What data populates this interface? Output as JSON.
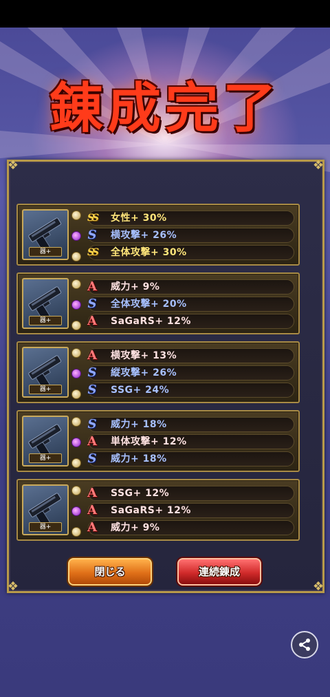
{
  "title": "錬成完了",
  "weapon_label": "器+",
  "colors": {
    "rank_S": "#8fa8ff",
    "rank_SS": "#ffd54a",
    "rank_A": "#ff7a7a",
    "frame_gold": "#b89a4a"
  },
  "cards": [
    {
      "sockets": [
        "white",
        "purple"
      ],
      "stats": [
        {
          "rank": "SS",
          "text": "女性+ 30%"
        },
        {
          "rank": "S",
          "text": "横攻撃+ 26%"
        },
        {
          "rank": "SS",
          "text": "全体攻撃+ 30%"
        }
      ]
    },
    {
      "sockets": [
        "white",
        "purple"
      ],
      "stats": [
        {
          "rank": "A",
          "text": "威力+ 9%"
        },
        {
          "rank": "S",
          "text": "全体攻撃+ 20%"
        },
        {
          "rank": "A",
          "text": "SaGaRS+ 12%"
        }
      ]
    },
    {
      "sockets": [
        "white",
        "purple"
      ],
      "stats": [
        {
          "rank": "A",
          "text": "横攻撃+ 13%"
        },
        {
          "rank": "S",
          "text": "縦攻撃+ 26%"
        },
        {
          "rank": "S",
          "text": "SSG+ 24%"
        }
      ]
    },
    {
      "sockets": [
        "white",
        "purple"
      ],
      "stats": [
        {
          "rank": "S",
          "text": "威力+ 18%"
        },
        {
          "rank": "A",
          "text": "単体攻撃+ 12%"
        },
        {
          "rank": "S",
          "text": "威力+ 18%"
        }
      ]
    },
    {
      "sockets": [
        "white",
        "purple"
      ],
      "stats": [
        {
          "rank": "A",
          "text": "SSG+ 12%"
        },
        {
          "rank": "A",
          "text": "SaGaRS+ 12%"
        },
        {
          "rank": "A",
          "text": "威力+ 9%"
        }
      ]
    }
  ],
  "buttons": {
    "close": "閉じる",
    "continue": "連続錬成"
  },
  "icons": {
    "share": "share-icon",
    "weapon": "handgun-icon"
  }
}
